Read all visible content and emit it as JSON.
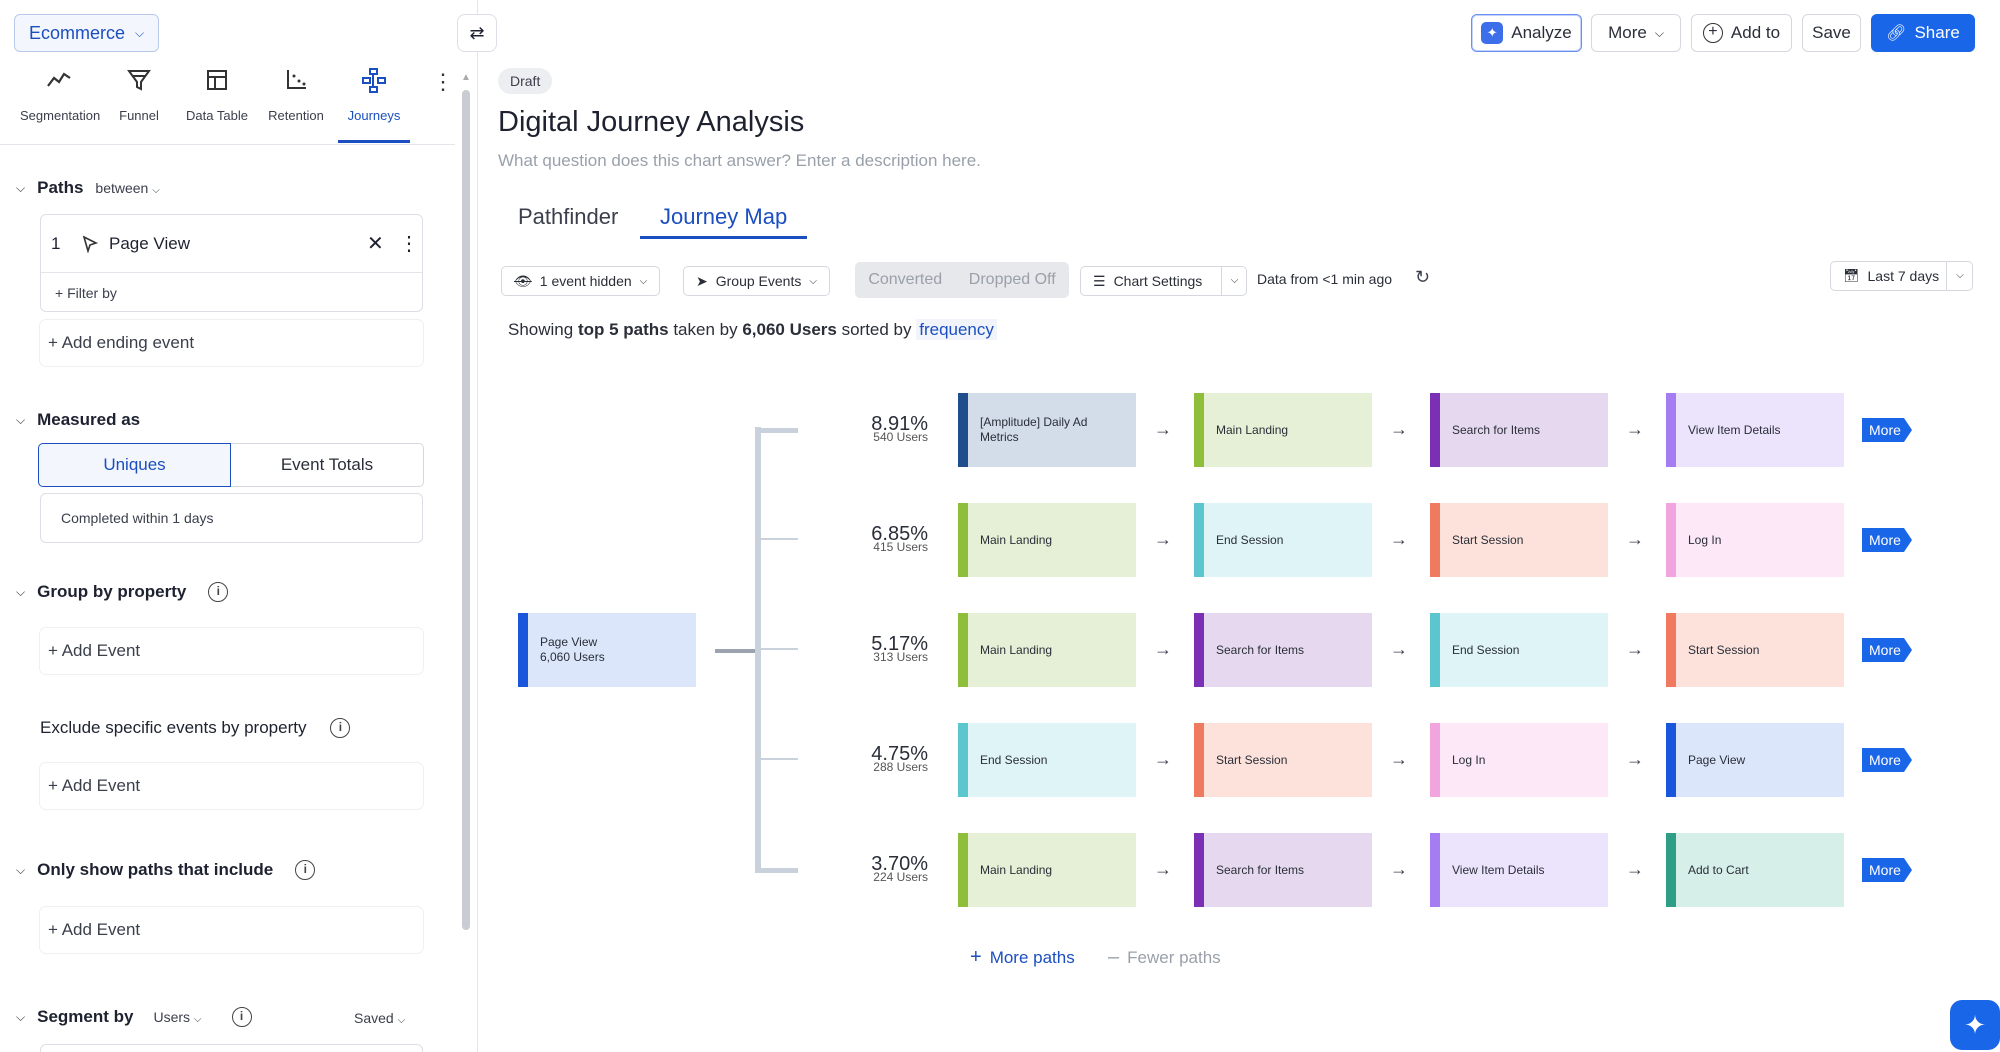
{
  "sidebar": {
    "workspace": "Ecommerce",
    "tools": [
      {
        "label": "Segmentation",
        "icon": "trend-line-icon"
      },
      {
        "label": "Funnel",
        "icon": "funnel-icon"
      },
      {
        "label": "Data Table",
        "icon": "table-icon"
      },
      {
        "label": "Retention",
        "icon": "retention-icon"
      },
      {
        "label": "Journeys",
        "icon": "journeys-icon"
      }
    ],
    "paths": {
      "heading": "Paths",
      "mode": "between",
      "step_number": "1",
      "step_event": "Page View",
      "filter_by": "+ Filter by",
      "add_ending": "+ Add ending event"
    },
    "measured": {
      "heading": "Measured as",
      "uniques": "Uniques",
      "totals": "Event Totals",
      "completed": "Completed within 1 days"
    },
    "group": {
      "heading": "Group by property",
      "add": "+ Add Event"
    },
    "exclude": {
      "heading": "Exclude specific events by property",
      "add": "+ Add Event"
    },
    "include": {
      "heading": "Only show paths that include",
      "add": "+ Add Event"
    },
    "segment": {
      "heading": "Segment by",
      "users": "Users",
      "saved": "Saved"
    }
  },
  "header": {
    "analyze": "Analyze",
    "more": "More",
    "add_to": "Add to",
    "save": "Save",
    "share": "Share"
  },
  "main": {
    "badge": "Draft",
    "title": "Digital Journey Analysis",
    "description": "What question does this chart answer? Enter a description here.",
    "tabs": [
      "Pathfinder",
      "Journey Map"
    ],
    "controls": {
      "hidden": "1 event hidden",
      "group_events": "Group Events",
      "converted": "Converted",
      "dropped": "Dropped Off",
      "chart_settings": "Chart Settings",
      "data_from": "Data from <1 min ago",
      "date_range": "Last 7 days"
    },
    "showing": {
      "prefix": "Showing ",
      "top": "top 5 paths",
      "mid": " taken by ",
      "users": "6,060 Users",
      "sorted": " sorted by ",
      "link": "frequency"
    },
    "more_paths": "More paths",
    "fewer_paths": "Fewer paths",
    "more_label": "More"
  },
  "journey": {
    "start": {
      "name": "Page View",
      "count": "6,060 Users",
      "color": "#1a56db",
      "bg": "#dbe6fb"
    },
    "colors": {
      "Main Landing": [
        "#8fbf3a",
        "#e6f0d6"
      ],
      "End Session": [
        "#5cc6cf",
        "#dff4f6"
      ],
      "Start Session": [
        "#f07a5f",
        "#fde2dc"
      ],
      "Log In": [
        "#f2a4df",
        "#fce8f7"
      ],
      "Search for Items": [
        "#7b2fb4",
        "#e6d9ef"
      ],
      "View Item Details": [
        "#a57cf2",
        "#ece4fc"
      ],
      "Page View": [
        "#1a56db",
        "#dbe6fb"
      ],
      "Add to Cart": [
        "#2e9e86",
        "#d6efe9"
      ],
      "[Amplitude] Daily Ad Metrics": [
        "#1f4e8c",
        "#d3dde9"
      ]
    },
    "paths": [
      {
        "pct": "8.91%",
        "count": "540 Users",
        "steps": [
          "[Amplitude] Daily Ad Metrics",
          "Main Landing",
          "Search for Items",
          "View Item Details"
        ],
        "share": 0.0891
      },
      {
        "pct": "6.85%",
        "count": "415 Users",
        "steps": [
          "Main Landing",
          "End Session",
          "Start Session",
          "Log In"
        ],
        "share": 0.0685
      },
      {
        "pct": "5.17%",
        "count": "313 Users",
        "steps": [
          "Main Landing",
          "Search for Items",
          "End Session",
          "Start Session"
        ],
        "share": 0.0517
      },
      {
        "pct": "4.75%",
        "count": "288 Users",
        "steps": [
          "End Session",
          "Start Session",
          "Log In",
          "Page View"
        ],
        "share": 0.0475
      },
      {
        "pct": "3.70%",
        "count": "224 Users",
        "steps": [
          "Main Landing",
          "Search for Items",
          "View Item Details",
          "Add to Cart"
        ],
        "share": 0.037
      }
    ]
  }
}
